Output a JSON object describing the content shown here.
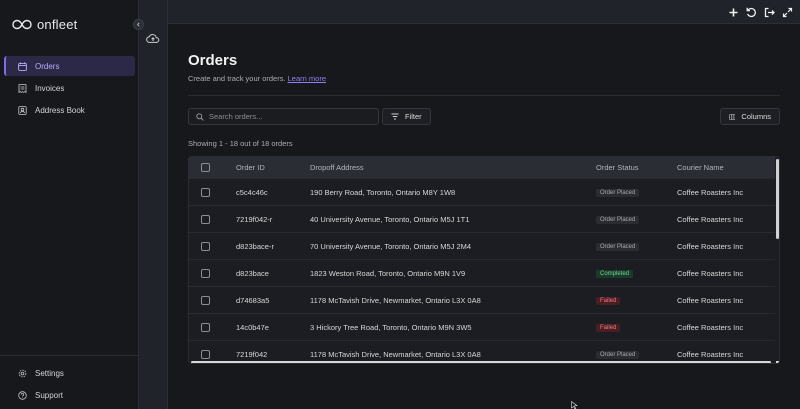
{
  "app": {
    "logo_text": "onfleet",
    "brand_color": "#7c6cf0"
  },
  "sidebar": {
    "items": [
      {
        "label": "Orders",
        "icon": "calendar-icon",
        "active": true
      },
      {
        "label": "Invoices",
        "icon": "receipt-icon",
        "active": false
      },
      {
        "label": "Address Book",
        "icon": "contact-book-icon",
        "active": false
      }
    ],
    "bottom_items": [
      {
        "label": "Settings",
        "icon": "gear-icon"
      },
      {
        "label": "Support",
        "icon": "help-circle-icon"
      }
    ]
  },
  "rail": {
    "icon": "cloud-upload-icon"
  },
  "topbar": {
    "icons": [
      "plus-icon",
      "refresh-icon",
      "sign-out-icon",
      "expand-icon"
    ]
  },
  "page": {
    "title": "Orders",
    "subtitle": "Create and track your orders.",
    "learn_more": "Learn more"
  },
  "toolbar": {
    "search_placeholder": "Search orders...",
    "filter_label": "Filter",
    "columns_label": "Columns"
  },
  "table": {
    "showing": "Showing 1 - 18 out of 18 orders",
    "headers": {
      "order_id": "Order ID",
      "address": "Dropoff Address",
      "status": "Order Status",
      "courier": "Courier Name"
    },
    "rows": [
      {
        "order_id": "c5c4c46c",
        "address": "190 Berry Road, Toronto, Ontario M8Y 1W8",
        "status": "Order Placed",
        "status_type": "placed",
        "courier": "Coffee Roasters Inc"
      },
      {
        "order_id": "7219f042-r",
        "address": "40 University Avenue, Toronto, Ontario M5J 1T1",
        "status": "Order Placed",
        "status_type": "placed",
        "courier": "Coffee Roasters Inc"
      },
      {
        "order_id": "d823bace-r",
        "address": "70 University Avenue, Toronto, Ontario M5J 2M4",
        "status": "Order Placed",
        "status_type": "placed",
        "courier": "Coffee Roasters Inc"
      },
      {
        "order_id": "d823bace",
        "address": "1823 Weston Road, Toronto, Ontario M9N 1V9",
        "status": "Completed",
        "status_type": "completed",
        "courier": "Coffee Roasters Inc"
      },
      {
        "order_id": "d74683a5",
        "address": "1178 McTavish Drive, Newmarket, Ontario L3X 0A8",
        "status": "Failed",
        "status_type": "failed",
        "courier": "Coffee Roasters Inc"
      },
      {
        "order_id": "14c0b47e",
        "address": "3 Hickory Tree Road, Toronto, Ontario M9N 3W5",
        "status": "Failed",
        "status_type": "failed",
        "courier": "Coffee Roasters Inc"
      },
      {
        "order_id": "7219f042",
        "address": "1178 McTavish Drive, Newmarket, Ontario L3X 0A8",
        "status": "Order Placed",
        "status_type": "placed",
        "courier": "Coffee Roasters Inc"
      }
    ]
  }
}
